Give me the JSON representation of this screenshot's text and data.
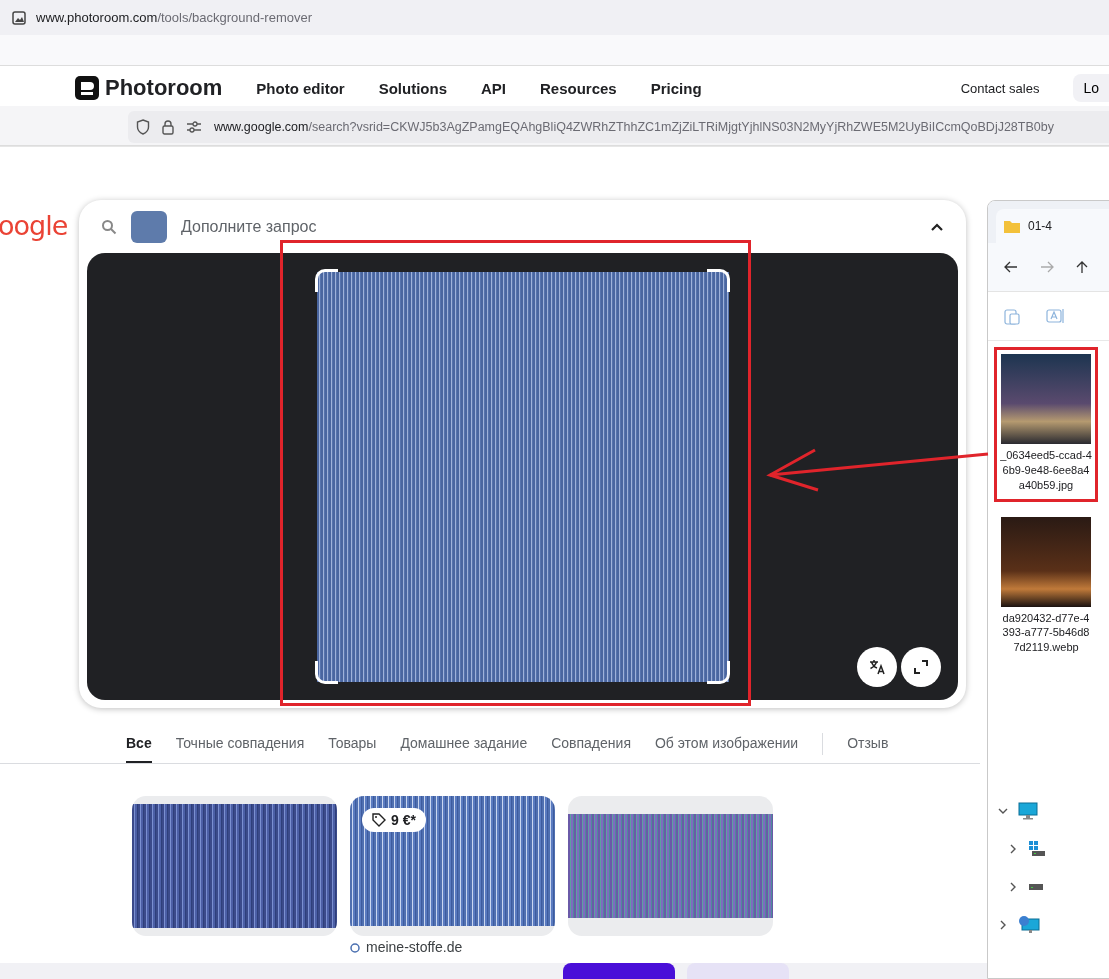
{
  "browser_back": {
    "url_domain": "www.photoroom.com",
    "url_path": "/tools/background-remover"
  },
  "photoroom_nav": {
    "logo": "Photoroom",
    "links": [
      "Photo editor",
      "Solutions",
      "API",
      "Resources",
      "Pricing"
    ],
    "contact": "Contact sales",
    "login": "Lo"
  },
  "browser_front": {
    "url_domain": "www.google.com",
    "url_path": "/search?vsrid=CKWJ5b3AgZPamgEQAhgBliQ4ZWRhZThhZC1mZjZiLTRiMjgtYjhlNS03N2MyYjRhZWE5M2UyBiICcmQoBDjJ28TB0by"
  },
  "google": {
    "logo": "oogle",
    "lens": {
      "placeholder": "Дополните запрос"
    },
    "tabs": [
      {
        "label": "Все",
        "selected": true
      },
      {
        "label": "Точные совпадения",
        "selected": false
      },
      {
        "label": "Товары",
        "selected": false
      },
      {
        "label": "Домашнее задание",
        "selected": false
      },
      {
        "label": "Совпадения",
        "selected": false
      },
      {
        "label": "Об этом изображении",
        "selected": false
      }
    ],
    "feedback": "Отзыв",
    "results": [
      {
        "kind": "plain"
      },
      {
        "kind": "product",
        "price": "9 €*",
        "source": "meine-stoffe.de"
      },
      {
        "kind": "plain"
      }
    ]
  },
  "explorer": {
    "tab": "01-4",
    "files": [
      {
        "name": "_0634eed5-ccad-46b9-9e48-6ee8a4a40b59.jpg",
        "highlighted": true
      },
      {
        "name": "da920432-d77e-4393-a777-5b46d87d2119.webp",
        "highlighted": false
      }
    ],
    "tree": [
      {
        "kind": "computer",
        "expanded": true,
        "children": [
          {
            "kind": "system-drive",
            "expanded": false
          },
          {
            "kind": "drive",
            "expanded": false
          }
        ]
      },
      {
        "kind": "network",
        "expanded": false
      }
    ]
  }
}
